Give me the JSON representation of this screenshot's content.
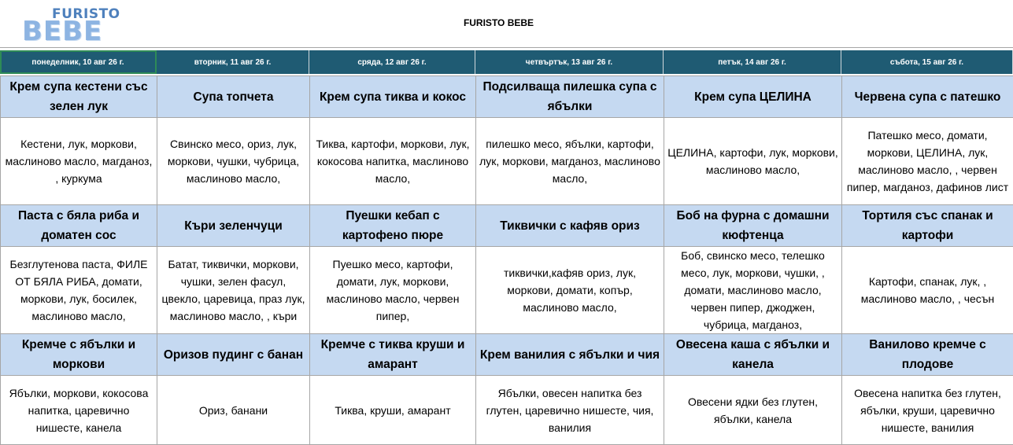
{
  "header": {
    "logo_top": "FURISTO",
    "logo_bottom": "BEBE",
    "title": "FURISTO BEBE"
  },
  "days": [
    "понеделник, 10 авг 26 г.",
    "вторник, 11 авг 26 г.",
    "сряда, 12 авг 26 г.",
    "четвъртък, 13 авг 26 г.",
    "петък, 14 авг 26 г.",
    "събота, 15 авг 26 г."
  ],
  "meals": [
    {
      "dishes": [
        "Крем супа кестени със зелен лук",
        "Супа топчета",
        "Крем супа тиква и кокос",
        "Подсилваща пилешка супа с ябълки",
        "Крем супа ЦЕЛИНА",
        "Червена супа с патешко"
      ],
      "ingredients": [
        "Кестени, лук, моркови, маслиново масло, магданоз, , куркума",
        "Свинско месо, ориз, лук, моркови, чушки, чубрица,   маслиново масло,",
        "Тиква, картофи, моркови, лук, кокосова напитка, маслиново масло,",
        "пилешко месо, ябълки, картофи, лук, моркови, магданоз,  маслиново масло,",
        "ЦЕЛИНА, картофи, лук, моркови,  маслиново масло,",
        "Патешко месо, домати, моркови, ЦЕЛИНА, лук, маслиново масло, , червен пипер, магданоз, дафинов лист"
      ]
    },
    {
      "dishes": [
        "Паста с бяла риба и доматен сос",
        "Къри зеленчуци",
        "Пуешки кебап с картофено пюре",
        "Тиквички с кафяв ориз",
        "Боб на фурна с домашни кюфтенца",
        "Тортиля със спанак и картофи"
      ],
      "ingredients": [
        "Безглутенова паста, ФИЛЕ ОТ БЯЛА РИБА, домати, моркови, лук, босилек, маслиново масло,",
        "Батат, тиквички, моркови, чушки, зелен фасул, цвекло, царевица, праз лук, маслиново масло, , къри",
        "Пуешко месо, картофи, домати, лук, моркови, маслиново масло, червен пипер,",
        "тиквички,кафяв ориз, лук, моркови,  домати,  копър, маслиново масло,",
        "Боб, свинско месо, телешко месо, лук, моркови, чушки, , домати,  маслиново масло, червен пипер, джоджен, чубрица, магданоз,",
        "Картофи, спанак,  лук, , маслиново масло, , чесън"
      ]
    },
    {
      "dishes": [
        "Кремче с ябълки и моркови",
        "Оризов пудинг с банан",
        "Кремче с тиква круши и амарант",
        "Крем ванилия с ябълки и чия",
        "Овесена каша с ябълки и канела",
        "Ванилово кремче с плодове"
      ],
      "ingredients": [
        "Ябълки, моркови, кокосова напитка, царевично нишесте, канела",
        "Ориз, банани",
        "Тиква, круши, амарант",
        "Ябълки, овесен напитка без глутен, царевично нишесте, чия, ванилия",
        "Овесени ядки без глутен, ябълки, канела",
        "Овесена напитка без глутен, ябълки, круши, царевично нишесте, ванилия"
      ]
    }
  ]
}
